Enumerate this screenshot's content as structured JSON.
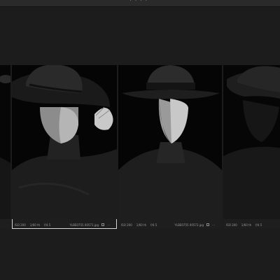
{
  "topbar": {
    "dots": "⠁⠁⠁⠁"
  },
  "thumbnails": [
    {
      "iso": "ISO 200",
      "shutter": "1/60 th",
      "aperture": "f/4.5",
      "filename": "YLBE0755 00571.jpg"
    },
    {
      "iso": "ISO 200",
      "shutter": "1/60 th",
      "aperture": "f/4.5",
      "filename": "YLBE0755 00572.jpg"
    },
    {
      "iso": "ISO 200",
      "shutter": "1/60 th",
      "aperture": "f/4.5",
      "filename": ""
    }
  ],
  "colors": {
    "background": "#1c1c1c",
    "selection_outline": "#d8d8d8"
  }
}
